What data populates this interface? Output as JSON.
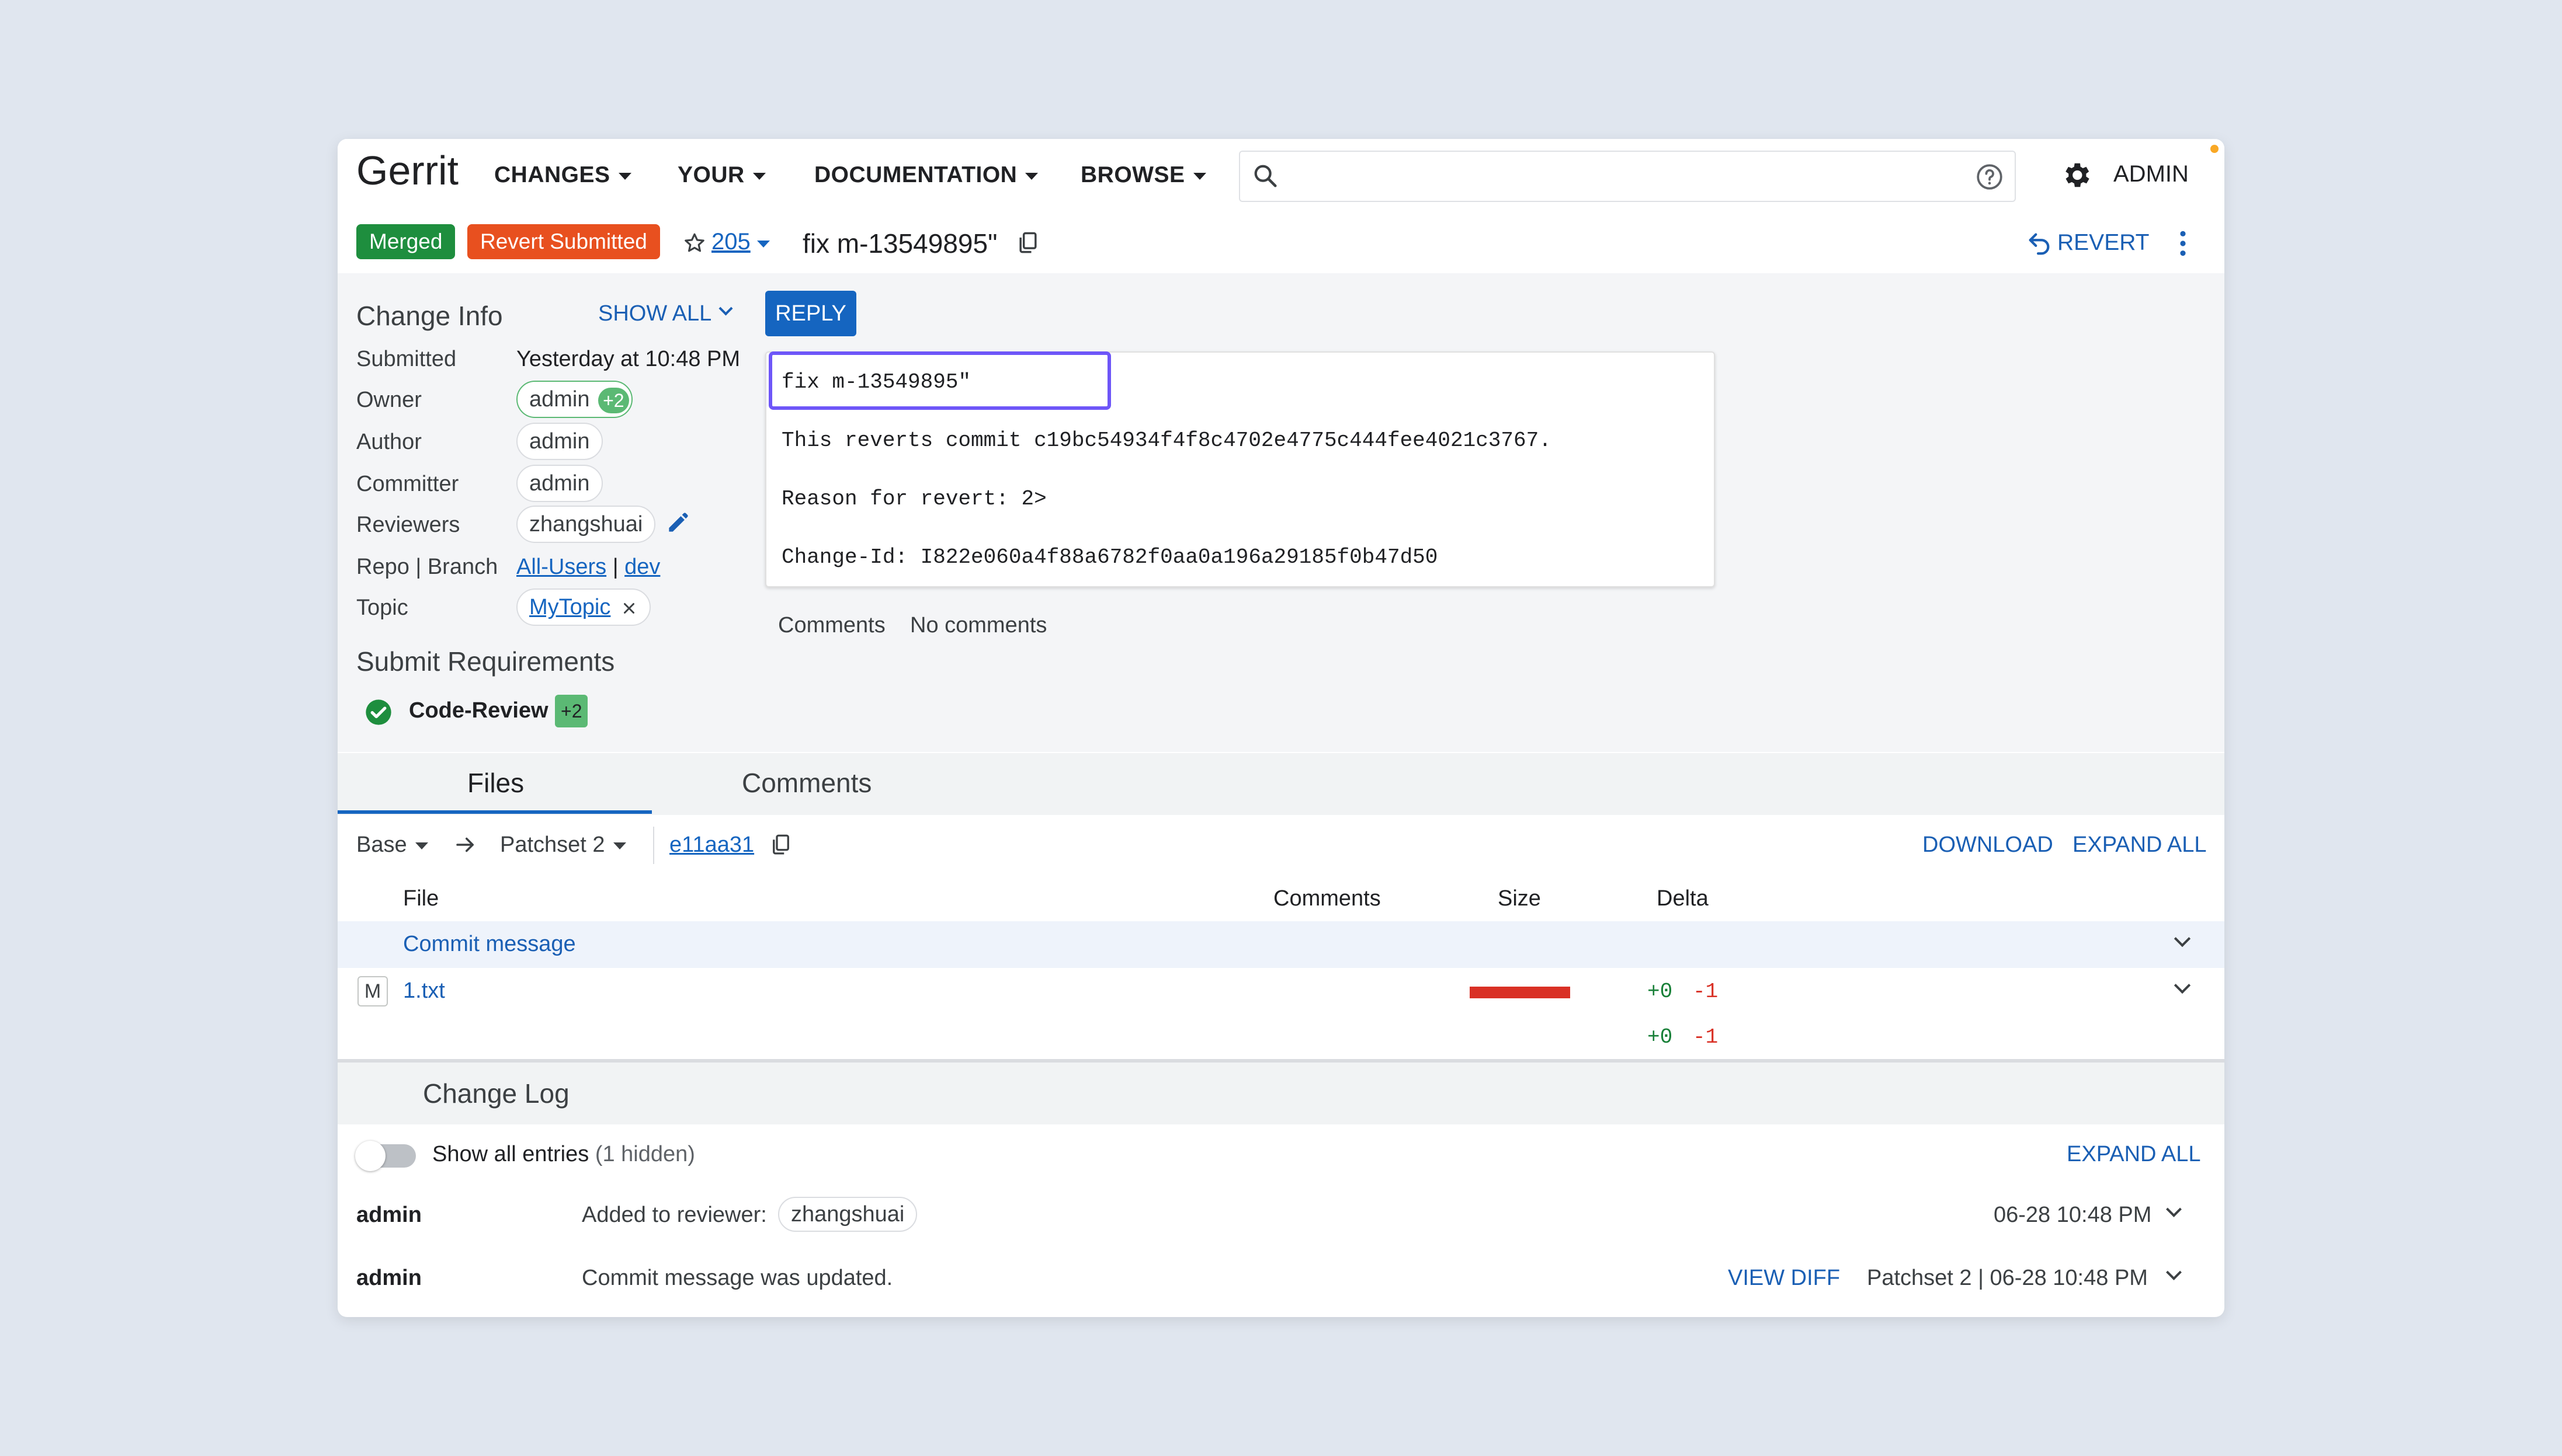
{
  "header": {
    "logo": "Gerrit",
    "nav": [
      "CHANGES",
      "YOUR",
      "DOCUMENTATION",
      "BROWSE"
    ],
    "user": "ADMIN"
  },
  "change": {
    "status_merged": "Merged",
    "status_revert": "Revert Submitted",
    "number": "205",
    "title": "fix m-13549895\"",
    "revert_label": "REVERT"
  },
  "change_info": {
    "title": "Change Info",
    "show_all": "SHOW ALL",
    "reply": "REPLY",
    "submitted_label": "Submitted",
    "submitted_value": "Yesterday at 10:48 PM",
    "owner_label": "Owner",
    "owner_value": "admin",
    "owner_vote": "+2",
    "author_label": "Author",
    "author_value": "admin",
    "committer_label": "Committer",
    "committer_value": "admin",
    "reviewers_label": "Reviewers",
    "reviewers_value": "zhangshuai",
    "repo_label": "Repo | Branch",
    "repo_value": "All-Users",
    "repo_sep": "|",
    "branch_value": "dev",
    "topic_label": "Topic",
    "topic_value": "MyTopic"
  },
  "commit_message": {
    "subject": "fix m-13549895\"",
    "line1": "This reverts commit c19bc54934f4f8c4702e4775c444fee4021c3767.",
    "line2": "Reason for revert: 2>",
    "line3": "Change-Id: I822e060a4f88a6782f0aa0a196a29185f0b47d50",
    "comments_label": "Comments",
    "comments_value": "No comments"
  },
  "submit_requirements": {
    "title": "Submit Requirements",
    "name": "Code-Review",
    "vote": "+2"
  },
  "tabs": [
    "Files",
    "Comments"
  ],
  "files": {
    "base": "Base",
    "patchset": "Patchset 2",
    "commit": "e11aa31",
    "download": "DOWNLOAD",
    "expand_all": "EXPAND ALL",
    "col_file": "File",
    "col_comments": "Comments",
    "col_size": "Size",
    "col_delta": "Delta",
    "commit_msg_row": "Commit message",
    "file_status": "M",
    "file_name": "1.txt",
    "file_added": "+0",
    "file_removed": "-1",
    "total_added": "+0",
    "total_removed": "-1"
  },
  "change_log": {
    "title": "Change Log",
    "show_all": "Show all entries",
    "hidden": "(1 hidden)",
    "expand_all": "EXPAND ALL",
    "entries": [
      {
        "user": "admin",
        "message": "Added to reviewer:",
        "chip": "zhangshuai",
        "time": "06-28 10:48 PM"
      },
      {
        "user": "admin",
        "message": "Commit message was updated.",
        "view_diff": "VIEW DIFF",
        "time": "Patchset 2 | 06-28 10:48 PM"
      }
    ]
  },
  "colors": {
    "merged": "#1e8e3e",
    "revert": "#e8501f",
    "accent": "#1565c0",
    "vote_green": "#5bb974"
  }
}
